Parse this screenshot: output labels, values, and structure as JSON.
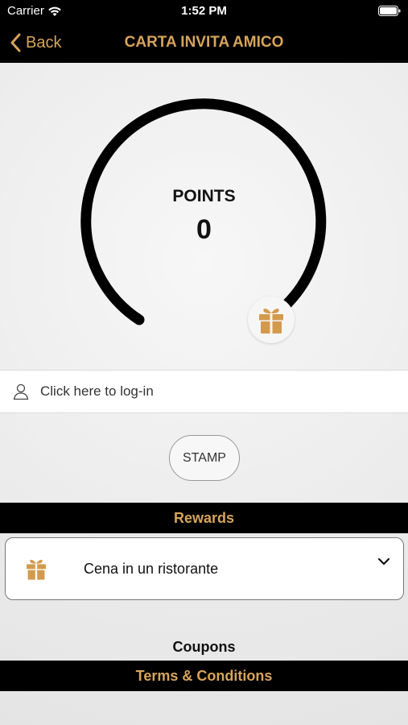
{
  "status_bar": {
    "carrier": "Carrier",
    "time": "1:52 PM"
  },
  "nav": {
    "back_label": "Back",
    "title": "CARTA INVITA AMICO"
  },
  "points": {
    "label": "POINTS",
    "value": "0",
    "progress": 0
  },
  "login": {
    "label": "Click here to log-in"
  },
  "stamp": {
    "label": "STAMP"
  },
  "rewards": {
    "title": "Rewards",
    "items": [
      {
        "name": "Cena in un ristorante",
        "icon": "gift-icon"
      }
    ]
  },
  "coupons": {
    "title": "Coupons"
  },
  "terms": {
    "title": "Terms & Conditions"
  },
  "colors": {
    "accent": "#d7a45b",
    "bar": "#000000",
    "gift": "#d39a4e"
  }
}
